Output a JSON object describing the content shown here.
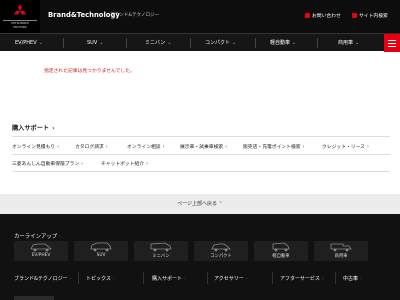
{
  "header": {
    "brand": "Brand&Technology",
    "brand_sub": "ブランド&テクノロジー",
    "contact": "お問い合わせ",
    "site_search": "サイト内検索",
    "logo_line1": "MITSUBISHI",
    "logo_line2": "MOTORS"
  },
  "nav": {
    "items": [
      {
        "label": "EV/PHEV"
      },
      {
        "label": "SUV"
      },
      {
        "label": "ミニバン"
      },
      {
        "label": "コンパクト"
      },
      {
        "label": "軽自動車"
      },
      {
        "label": "商用車"
      }
    ]
  },
  "main": {
    "not_found": "指定された記事は見つかりませんでした。",
    "purchase_support": "購入サポート",
    "links_row1": [
      "オンライン見積もり",
      "カタログ請求",
      "オンライン相談",
      "展示車・試乗車検索",
      "販売店・充電ポイント検索",
      "クレジット・リース"
    ],
    "links_row2": [
      "三菱あんしん自動車保険プラン",
      "チャットボット紹介"
    ]
  },
  "back_to_top": "ページ上部へ戻る",
  "footer": {
    "lineup_title": "カーラインアップ",
    "cars": [
      "EV/PHEV",
      "SUV",
      "ミニバン",
      "コンパクト",
      "軽自動車",
      "商用車"
    ],
    "links": [
      "ブランド&テクノロジー",
      "トピックス",
      "購入サポート",
      "アクセサリー",
      "アフターサービス",
      "中古車"
    ]
  },
  "colors": {
    "accent": "#e60012",
    "header_bg": "#0d0d0d",
    "footer_bg": "#111111"
  }
}
